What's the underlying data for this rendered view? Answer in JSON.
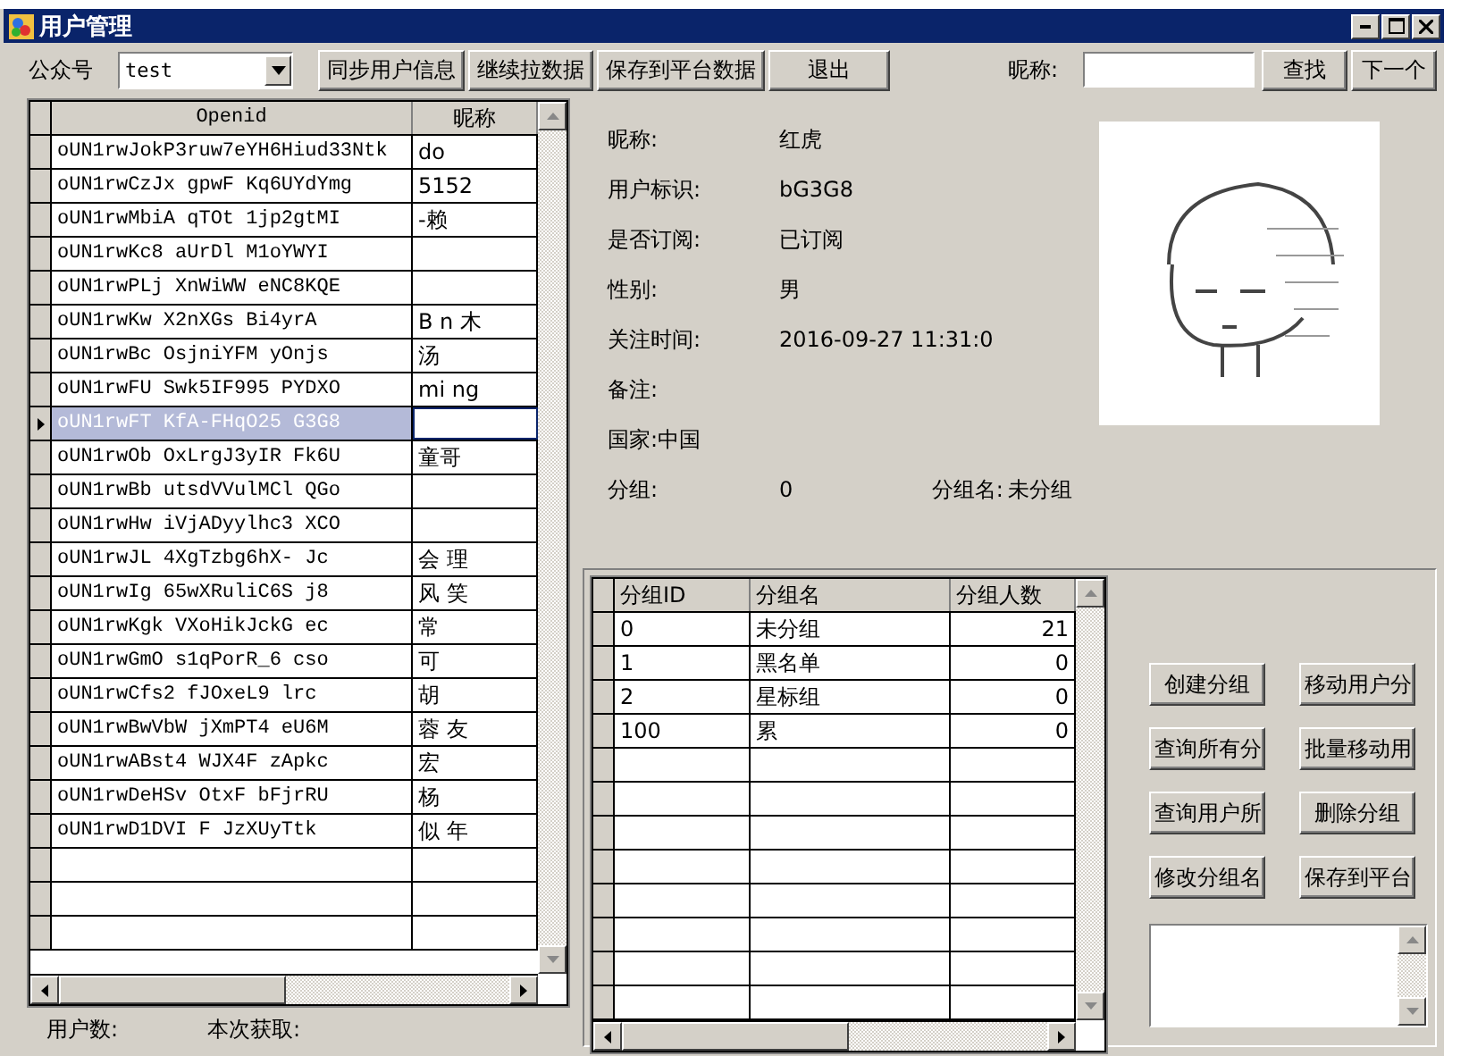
{
  "window": {
    "title": "用户管理"
  },
  "toolbar": {
    "account_label": "公众号",
    "account_value": "test",
    "buttons": [
      "同步用户信息",
      "继续拉数据",
      "保存到平台数据",
      "退出"
    ],
    "nickname_label": "昵称:",
    "search_button": "查找",
    "next_button": "下一个"
  },
  "users_table": {
    "columns": [
      "Openid",
      "昵称"
    ],
    "rows": [
      {
        "openid": "oUN1rwJokP3ruw7eYH6Hiud33Ntk",
        "nickname": "do",
        "selected": false
      },
      {
        "openid": "oUN1rwCzJx gpwF Kq6UYdYmg",
        "nickname": "5152",
        "selected": false
      },
      {
        "openid": "oUN1rwMbiA qTOt 1jp2gtMI",
        "nickname": "-赖",
        "selected": false
      },
      {
        "openid": "oUN1rwKc8 aUrDl M1oYWYI",
        "selected": false
      },
      {
        "openid": "oUN1rwPLj XnWiWW eNC8KQE",
        "selected": false
      },
      {
        "openid": "oUN1rwKw X2nXGs Bi4yrA",
        "nickname": "B n 木",
        "selected": false
      },
      {
        "openid": "oUN1rwBc OsjniYFM yOnjs",
        "nickname": "汤",
        "selected": false
      },
      {
        "openid": "oUN1rwFU Swk5IF995 PYDXO",
        "nickname": "mi ng",
        "selected": false
      },
      {
        "openid": "oUN1rwFT KfA-FHqO25 G3G8",
        "selected": true
      },
      {
        "openid": "oUN1rwOb OxLrgJ3yIR Fk6U",
        "nickname": "童哥",
        "selected": false
      },
      {
        "openid": "oUN1rwBb utsdVVulMCl QGo",
        "selected": false
      },
      {
        "openid": "oUN1rwHw iVjADyylhc3 XCO",
        "selected": false
      },
      {
        "openid": "oUN1rwJL 4XgTzbg6hX- Jc",
        "nickname": "会 理",
        "selected": false
      },
      {
        "openid": "oUN1rwIg 65wXRuliC6S j8",
        "nickname": "风 笑",
        "selected": false
      },
      {
        "openid": "oUN1rwKgk VXoHikJckG ec",
        "nickname": "常",
        "selected": false
      },
      {
        "openid": "oUN1rwGmO s1qPorR_6 cso",
        "nickname": "可",
        "selected": false
      },
      {
        "openid": "oUN1rwCfs2 fJOxeL9 lrc",
        "nickname": "胡",
        "selected": false
      },
      {
        "openid": "oUN1rwBwVbW jXmPT4 eU6M",
        "nickname": "蓉 友",
        "selected": false
      },
      {
        "openid": "oUN1rwABst4 WJX4F zApkc",
        "nickname": "宏",
        "selected": false
      },
      {
        "openid": "oUN1rwDeHSv OtxF bFjrRU",
        "nickname": "杨",
        "selected": false
      },
      {
        "openid": "oUN1rwD1DVI F JzXUyTtk",
        "nickname": "似 年",
        "selected": false
      }
    ]
  },
  "status": {
    "user_count_label": "用户数:",
    "fetched_label": "本次获取:"
  },
  "details": {
    "fields": [
      {
        "label": "昵称:",
        "value": "红虎"
      },
      {
        "label": "用户标识:",
        "value": "bG3G8"
      },
      {
        "label": "是否订阅:",
        "value": "已订阅"
      },
      {
        "label": "性别:",
        "value": "男"
      },
      {
        "label": "关注时间:",
        "value": "2016-09-27 11:31:0"
      },
      {
        "label": "备注:"
      },
      {
        "label": "国家:中国"
      }
    ],
    "group_label": "分组:",
    "group_value": "0",
    "group_name_label": "分组名:",
    "group_name_value": "未分组"
  },
  "groups_table": {
    "columns": [
      "分组ID",
      "分组名",
      "分组人数"
    ],
    "rows": [
      {
        "id": "0",
        "name": "未分组",
        "count": "21"
      },
      {
        "id": "1",
        "name": "黑名单",
        "count": "0"
      },
      {
        "id": "2",
        "name": "星标组",
        "count": "0"
      },
      {
        "id": "100",
        "name": "累",
        "count": "0"
      }
    ]
  },
  "group_buttons": [
    "创建分组",
    "移动用户分",
    "查询所有分",
    "批量移动用",
    "查询用户所",
    "删除分组",
    "修改分组名",
    "保存到平台"
  ]
}
